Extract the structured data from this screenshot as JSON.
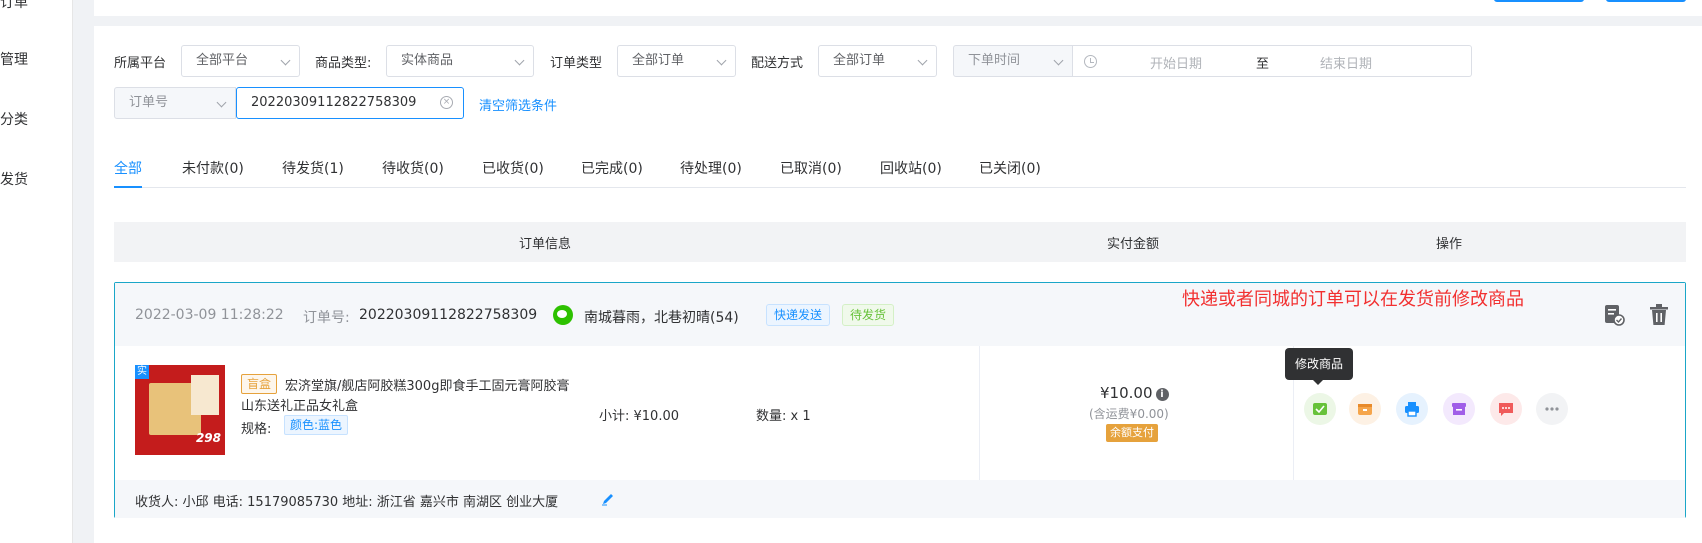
{
  "sidebar": {
    "items": [
      {
        "label": "订单"
      },
      {
        "label": "管理"
      },
      {
        "label": "分类"
      },
      {
        "label": "发货"
      }
    ]
  },
  "filters": {
    "platform_label": "所属平台",
    "platform_value": "全部平台",
    "goods_type_label": "商品类型:",
    "goods_type_value": "实体商品",
    "order_type_label": "订单类型",
    "order_type_value": "全部订单",
    "delivery_label": "配送方式",
    "delivery_value": "全部订单",
    "time_type_value": "下单时间",
    "start_date_placeholder": "开始日期",
    "range_separator": "至",
    "end_date_placeholder": "结束日期",
    "search_field_value": "订单号",
    "search_input_value": "20220309112822758309",
    "clear_link": "清空筛选条件"
  },
  "tabs": [
    {
      "label": "全部",
      "active": true
    },
    {
      "label": "未付款(0)"
    },
    {
      "label": "待发货(1)"
    },
    {
      "label": "待收货(0)"
    },
    {
      "label": "已收货(0)"
    },
    {
      "label": "已完成(0)"
    },
    {
      "label": "待处理(0)"
    },
    {
      "label": "已取消(0)"
    },
    {
      "label": "回收站(0)"
    },
    {
      "label": "已关闭(0)"
    }
  ],
  "table_header": {
    "order_info": "订单信息",
    "paid_amount": "实付金额",
    "actions": "操作"
  },
  "order": {
    "created_at": "2022-03-09 11:28:22",
    "order_no_label": "订单号:",
    "order_no": "20220309112822758309",
    "buyer": "南城暮雨，北巷初晴(54)",
    "tag_delivery": "快递发送",
    "tag_status": "待发货",
    "note": "快递或者同城的订单可以在发货前修改商品",
    "product": {
      "ribbon": "实",
      "thumb_price": "298",
      "blind_box_tag": "盲盒",
      "title_line1": "宏济堂旗/舰店阿胶糕300g即食手工固元膏阿胶膏",
      "title_line2": "山东送礼正品女礼盒",
      "spec_label": "规格:",
      "spec_value": "颜色:蓝色",
      "subtotal": "小计: ¥10.00",
      "quantity": "数量: x 1"
    },
    "amount": "¥10.00",
    "amount_info_glyph": "i",
    "shipping": "(含运费¥0.00)",
    "pay_method": "余额支付",
    "tooltip": "修改商品",
    "footer": "收货人: 小邱 电话: 15179085730 地址: 浙江省 嘉兴市 南湖区 创业大厦"
  },
  "colors": {
    "accent": "#1890ff",
    "note_red": "#f23030",
    "op_green": "#67c23a",
    "op_orange": "#f5a54b",
    "op_blue": "#1890ff",
    "op_purple": "#a05ee8",
    "op_red": "#f05a5a",
    "op_gray": "#909399"
  }
}
